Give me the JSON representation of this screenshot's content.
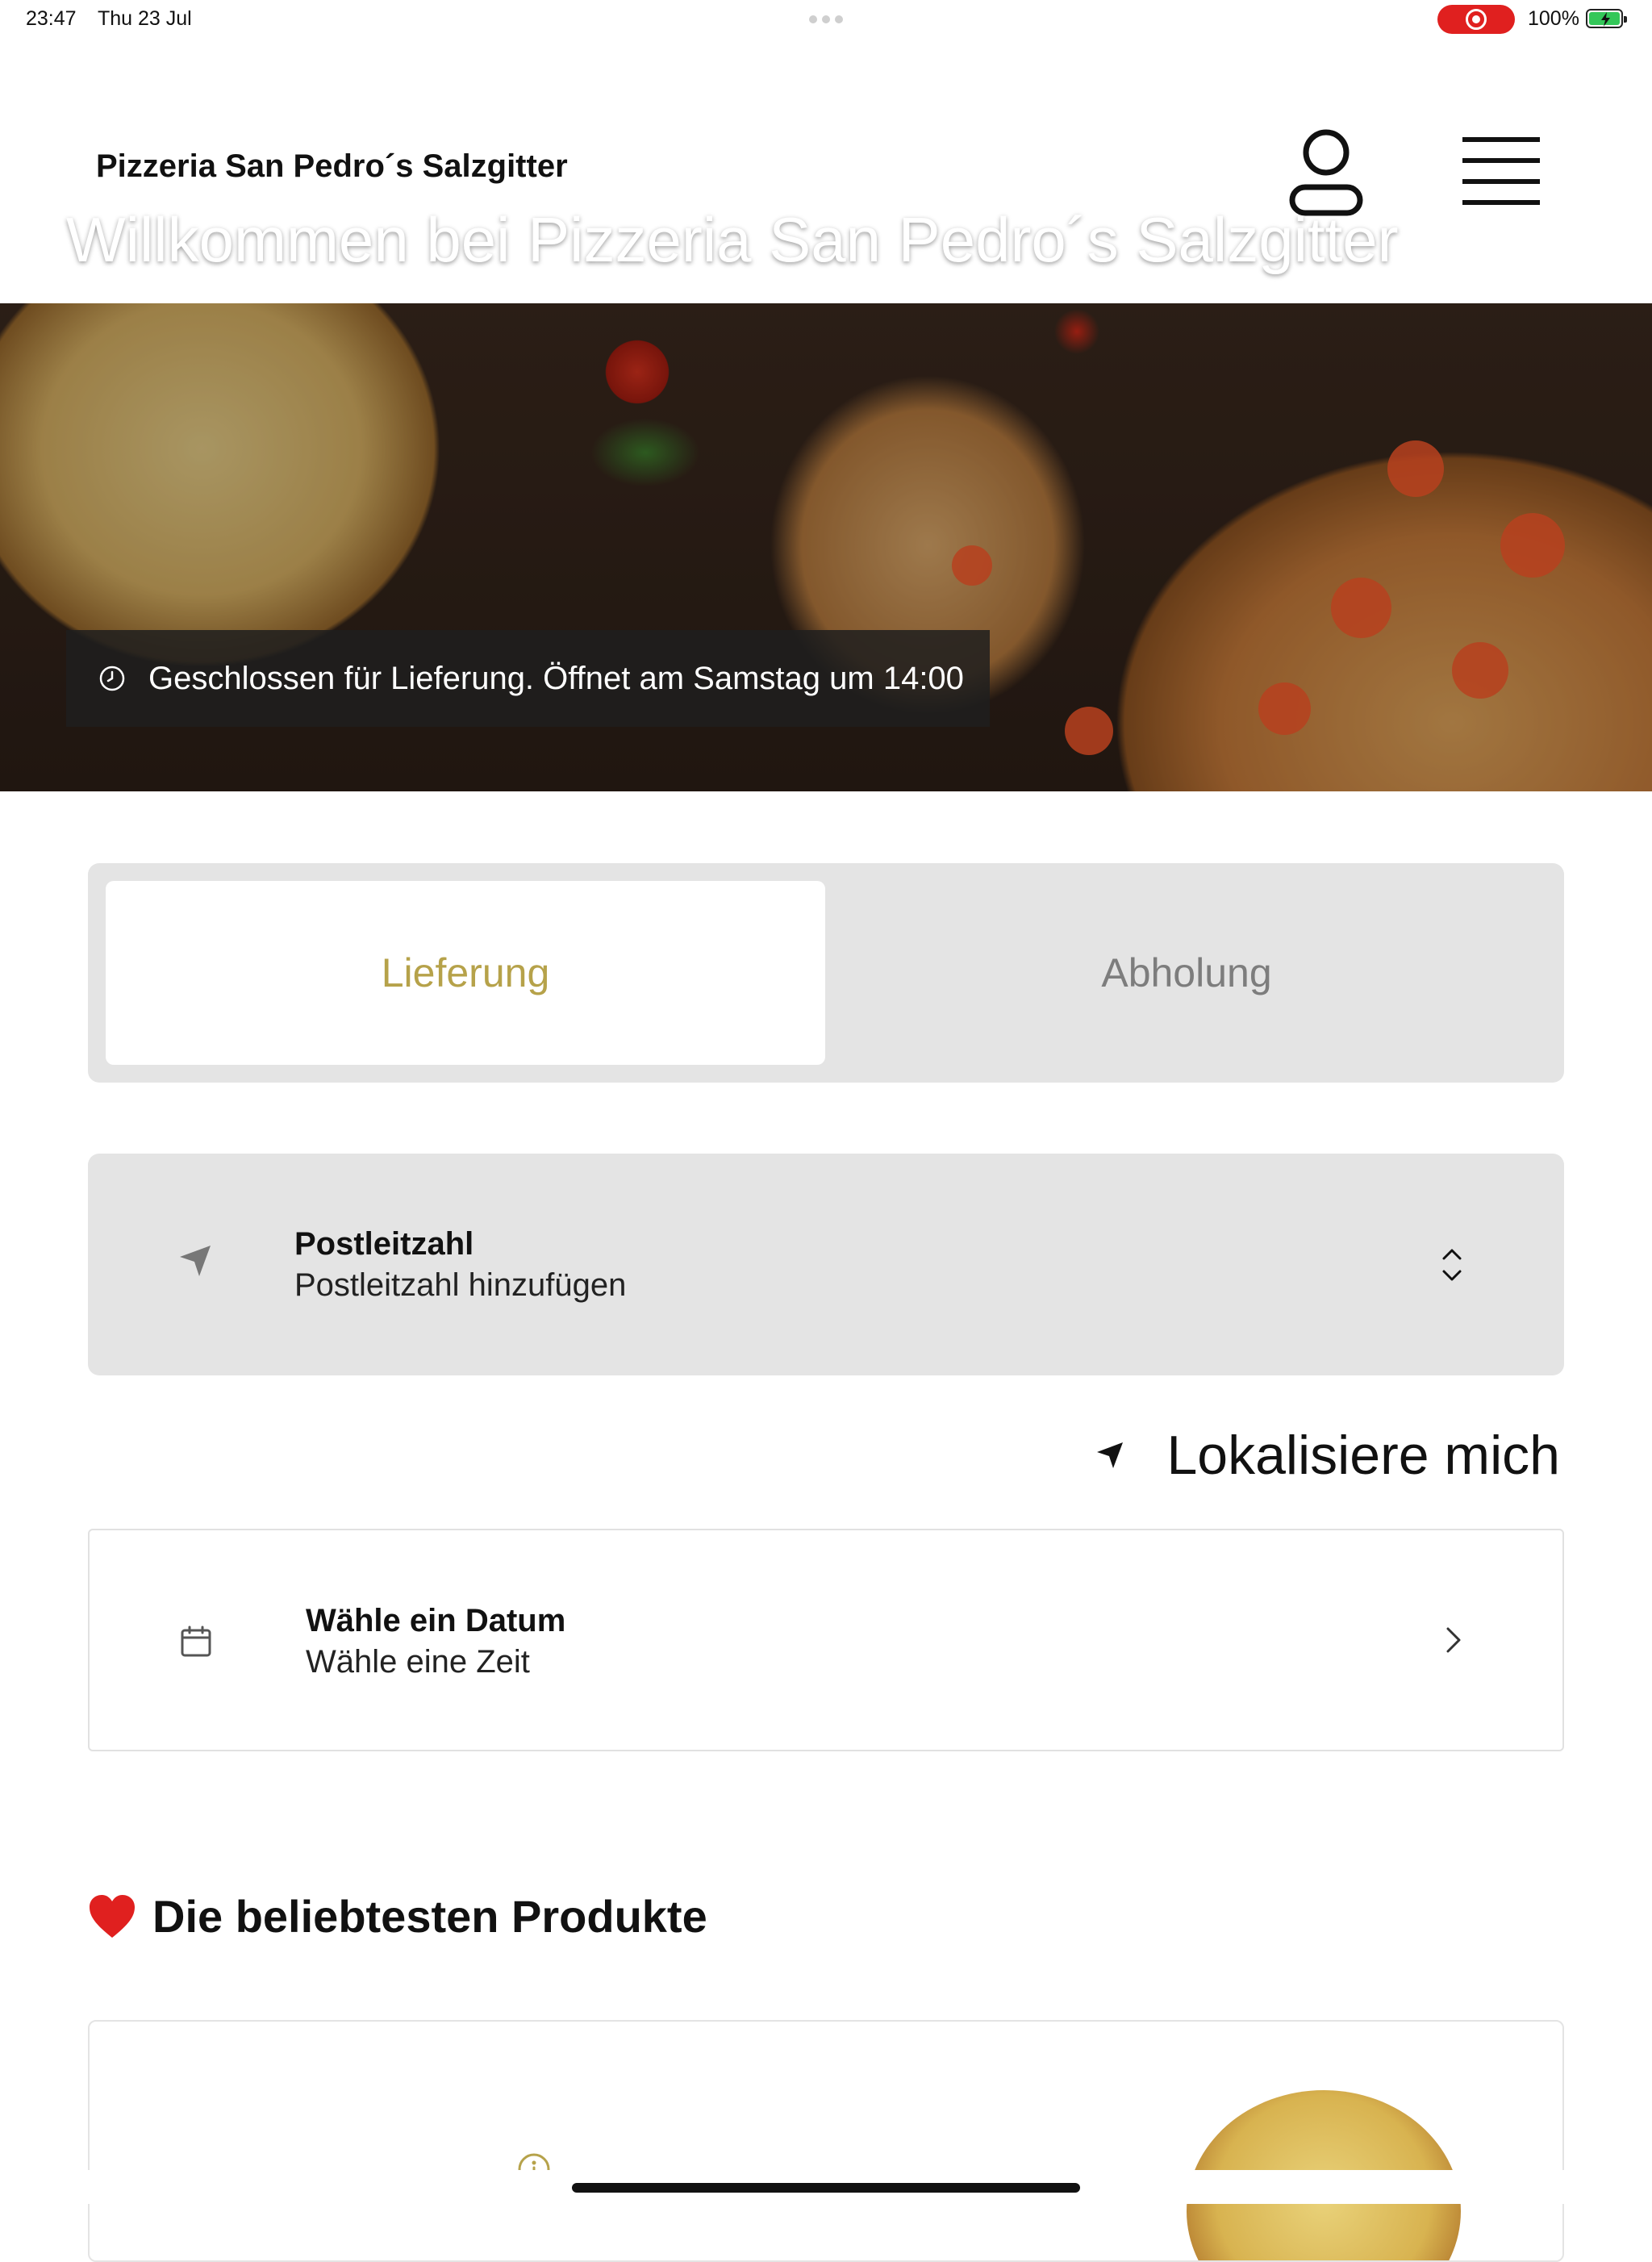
{
  "status_bar": {
    "time": "23:47",
    "date": "Thu 23 Jul",
    "battery_percent": "100%",
    "battery_level": 1.0,
    "recording_icon": "screen-record-icon",
    "battery_icon": "battery-charging-icon"
  },
  "header": {
    "brand": "Pizzeria San Pedro´s Salzgitter",
    "user_icon": "user-icon",
    "menu_icon": "hamburger-menu-icon"
  },
  "hero": {
    "title": "Willkommen bei Pizzeria San Pedro´s Salzgitter",
    "status_text": "Geschlossen für Lieferung. Öffnet am Samstag um 14:00",
    "status_icon": "clock-icon"
  },
  "order_mode": {
    "tabs": [
      {
        "label": "Lieferung",
        "active": true
      },
      {
        "label": "Abholung",
        "active": false
      }
    ],
    "active_color": "#b6a24a",
    "inactive_color": "#7d7d7d"
  },
  "postcode": {
    "label": "Postleitzahl",
    "placeholder": "Postleitzahl hinzufügen",
    "icon": "location-arrow-icon",
    "chevron_icon": "chevron-up-down-icon"
  },
  "locate": {
    "label": "Lokalisiere mich",
    "icon": "location-arrow-icon"
  },
  "schedule": {
    "date_label": "Wähle ein Datum",
    "time_label": "Wähle eine Zeit",
    "icon": "calendar-icon",
    "chevron_icon": "chevron-right-icon"
  },
  "popular": {
    "title": "Die beliebtesten Produkte",
    "icon": "heart-icon",
    "heart_color": "#e0201f"
  }
}
